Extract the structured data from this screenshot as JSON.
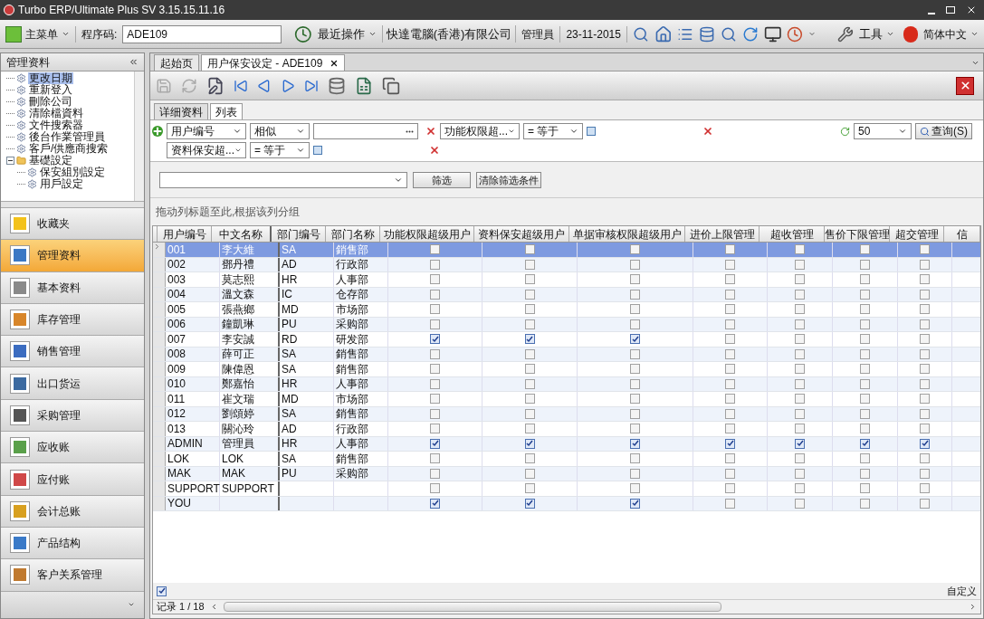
{
  "window": {
    "title": "Turbo ERP/Ultimate Plus SV 3.15.15.11.16"
  },
  "toolbar": {
    "main_menu": "主菜单",
    "program_code_label": "程序码:",
    "program_code": "ADE109",
    "recent": "最近操作",
    "company": "快達電腦(香港)有限公司",
    "user": "管理員",
    "date": "23-11-2015",
    "tools": "工具",
    "language": "简体中文"
  },
  "sidebar": {
    "title": "管理资料",
    "tree": [
      {
        "label": "更改日期",
        "selected": true
      },
      {
        "label": "重新登入",
        "selected": false
      },
      {
        "label": "刪除公司",
        "selected": false
      },
      {
        "label": "清除檔資料",
        "selected": false
      },
      {
        "label": "文件搜索器",
        "selected": false
      },
      {
        "label": "後台作業管理員",
        "selected": false
      },
      {
        "label": "客戶/供應商搜索",
        "selected": false
      },
      {
        "label": "基礎設定",
        "selected": false,
        "expanded": true,
        "children": [
          {
            "label": "保安組別設定",
            "selected": false
          },
          {
            "label": "用戶設定",
            "selected": false
          }
        ]
      }
    ],
    "nav": [
      {
        "label": "收藏夹",
        "selected": false
      },
      {
        "label": "管理资料",
        "selected": true
      },
      {
        "label": "基本资料",
        "selected": false
      },
      {
        "label": "库存管理",
        "selected": false
      },
      {
        "label": "销售管理",
        "selected": false
      },
      {
        "label": "出口货运",
        "selected": false
      },
      {
        "label": "采购管理",
        "selected": false
      },
      {
        "label": "应收账",
        "selected": false
      },
      {
        "label": "应付账",
        "selected": false
      },
      {
        "label": "会计总账",
        "selected": false
      },
      {
        "label": "产品结构",
        "selected": false
      },
      {
        "label": "客户关系管理",
        "selected": false
      }
    ]
  },
  "doc_tabs": [
    {
      "label": "起始页",
      "selected": false
    },
    {
      "label": "用户保安设定 - ADE109",
      "selected": true
    }
  ],
  "sub_tabs": [
    {
      "label": "详细资料",
      "selected": false
    },
    {
      "label": "列表",
      "selected": true
    }
  ],
  "filters": {
    "conditions": [
      {
        "kind": "text",
        "field": "用户编号",
        "operator": "相似"
      },
      {
        "kind": "boolean",
        "field": "功能权限超...",
        "operator": "= 等于"
      },
      {
        "kind": "boolean",
        "field": "资料保安超...",
        "operator": "= 等于"
      }
    ],
    "limit": "50",
    "query_button": "查询(S)",
    "apply": "筛选",
    "clear": "清除筛选条件"
  },
  "group_hint": "拖动列标题至此,根据该列分组",
  "table": {
    "columns": [
      "用户编号",
      "中文名称",
      "部门编号",
      "部门名称",
      "功能权限超级用户",
      "资料保安超级用户",
      "单据审核权限超级用户",
      "进价上限管理",
      "超收管理",
      "售价下限管理",
      "超交管理",
      "信"
    ],
    "rows": [
      {
        "selected": true,
        "cells": [
          "001",
          "李大維",
          "SA",
          "銷售部"
        ],
        "flags": [
          false,
          false,
          false,
          false,
          false,
          false,
          false
        ]
      },
      {
        "selected": false,
        "cells": [
          "002",
          "鄧丹禮",
          "AD",
          "行政部"
        ],
        "flags": [
          false,
          false,
          false,
          false,
          false,
          false,
          false
        ]
      },
      {
        "selected": false,
        "cells": [
          "003",
          "莫志熙",
          "HR",
          "人事部"
        ],
        "flags": [
          false,
          false,
          false,
          false,
          false,
          false,
          false
        ]
      },
      {
        "selected": false,
        "cells": [
          "004",
          "溫文森",
          "IC",
          "仓存部"
        ],
        "flags": [
          false,
          false,
          false,
          false,
          false,
          false,
          false
        ]
      },
      {
        "selected": false,
        "cells": [
          "005",
          "張燕鄉",
          "MD",
          "市场部"
        ],
        "flags": [
          false,
          false,
          false,
          false,
          false,
          false,
          false
        ]
      },
      {
        "selected": false,
        "cells": [
          "006",
          "鐘凱琳",
          "PU",
          "采购部"
        ],
        "flags": [
          false,
          false,
          false,
          false,
          false,
          false,
          false
        ]
      },
      {
        "selected": false,
        "cells": [
          "007",
          "李安誠",
          "RD",
          "研发部"
        ],
        "flags": [
          true,
          true,
          true,
          false,
          false,
          false,
          false
        ]
      },
      {
        "selected": false,
        "cells": [
          "008",
          "薛可正",
          "SA",
          "銷售部"
        ],
        "flags": [
          false,
          false,
          false,
          false,
          false,
          false,
          false
        ]
      },
      {
        "selected": false,
        "cells": [
          "009",
          "陳偉恩",
          "SA",
          "銷售部"
        ],
        "flags": [
          false,
          false,
          false,
          false,
          false,
          false,
          false
        ]
      },
      {
        "selected": false,
        "cells": [
          "010",
          "鄭嘉怡",
          "HR",
          "人事部"
        ],
        "flags": [
          false,
          false,
          false,
          false,
          false,
          false,
          false
        ]
      },
      {
        "selected": false,
        "cells": [
          "011",
          "崔文瑞",
          "MD",
          "市场部"
        ],
        "flags": [
          false,
          false,
          false,
          false,
          false,
          false,
          false
        ]
      },
      {
        "selected": false,
        "cells": [
          "012",
          "劉頌婷",
          "SA",
          "銷售部"
        ],
        "flags": [
          false,
          false,
          false,
          false,
          false,
          false,
          false
        ]
      },
      {
        "selected": false,
        "cells": [
          "013",
          "關沁玲",
          "AD",
          "行政部"
        ],
        "flags": [
          false,
          false,
          false,
          false,
          false,
          false,
          false
        ]
      },
      {
        "selected": false,
        "cells": [
          "ADMIN",
          "管理員",
          "HR",
          "人事部"
        ],
        "flags": [
          true,
          true,
          true,
          true,
          true,
          true,
          true
        ]
      },
      {
        "selected": false,
        "cells": [
          "LOK",
          "LOK",
          "SA",
          "銷售部"
        ],
        "flags": [
          false,
          false,
          false,
          false,
          false,
          false,
          false
        ]
      },
      {
        "selected": false,
        "cells": [
          "MAK",
          "MAK",
          "PU",
          "采购部"
        ],
        "flags": [
          false,
          false,
          false,
          false,
          false,
          false,
          false
        ]
      },
      {
        "selected": false,
        "cells": [
          "SUPPORT",
          "SUPPORT",
          "",
          ""
        ],
        "flags": [
          false,
          false,
          false,
          false,
          false,
          false,
          false
        ]
      },
      {
        "selected": false,
        "cells": [
          "YOU",
          "",
          "",
          ""
        ],
        "flags": [
          true,
          true,
          true,
          false,
          false,
          false,
          false
        ]
      }
    ]
  },
  "footer": {
    "filter_enabled": true,
    "customize": "自定义",
    "record": "记录 1 / 18"
  }
}
